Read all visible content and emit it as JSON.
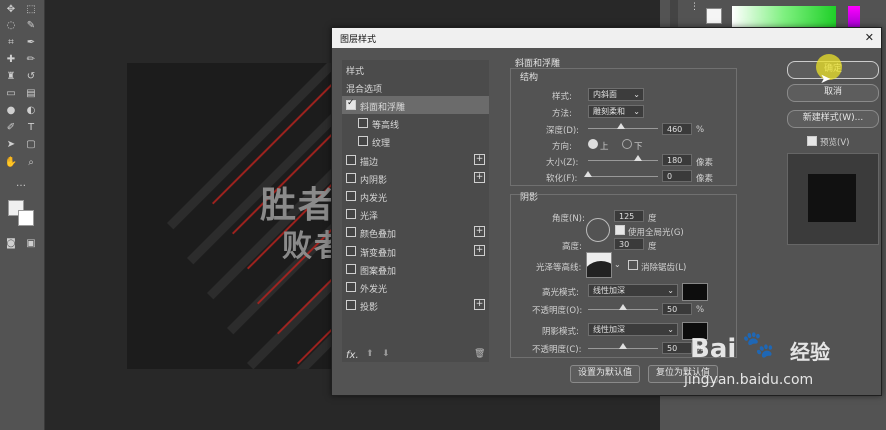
{
  "dialog": {
    "title": "图层样式",
    "close": "✕",
    "style_list": {
      "header": "样式",
      "blend": "混合选项",
      "items": [
        {
          "label": "斜面和浮雕",
          "checked": true,
          "selected": true,
          "plus": false
        },
        {
          "label": "等高线",
          "checked": false,
          "selected": false,
          "plus": false
        },
        {
          "label": "纹理",
          "checked": false,
          "selected": false,
          "plus": false
        },
        {
          "label": "描边",
          "checked": false,
          "selected": false,
          "plus": true
        },
        {
          "label": "内阴影",
          "checked": false,
          "selected": false,
          "plus": true
        },
        {
          "label": "内发光",
          "checked": false,
          "selected": false,
          "plus": false
        },
        {
          "label": "光泽",
          "checked": false,
          "selected": false,
          "plus": false
        },
        {
          "label": "颜色叠加",
          "checked": false,
          "selected": false,
          "plus": true
        },
        {
          "label": "渐变叠加",
          "checked": false,
          "selected": false,
          "plus": true
        },
        {
          "label": "图案叠加",
          "checked": false,
          "selected": false,
          "plus": false
        },
        {
          "label": "外发光",
          "checked": false,
          "selected": false,
          "plus": false
        },
        {
          "label": "投影",
          "checked": false,
          "selected": false,
          "plus": true
        }
      ],
      "fx": "fx."
    },
    "bevel": {
      "section_title": "斜面和浮雕",
      "structure_title": "结构",
      "style_label": "样式:",
      "style_value": "内斜面",
      "technique_label": "方法:",
      "technique_value": "雕刻柔和",
      "depth_label": "深度(D):",
      "depth_value": "460",
      "depth_unit": "%",
      "depth_level": 0.46,
      "direction_label": "方向:",
      "dir_up": "上",
      "dir_down": "下",
      "size_label": "大小(Z):",
      "size_value": "180",
      "size_unit": "像素",
      "size_level": 0.72,
      "soften_label": "软化(F):",
      "soften_value": "0",
      "soften_unit": "像素",
      "soften_level": 0.0
    },
    "shading": {
      "title": "阴影",
      "angle_label": "角度(N):",
      "angle_value": "125",
      "angle_unit": "度",
      "global_light_label": "使用全局光(G)",
      "altitude_label": "高度:",
      "altitude_value": "30",
      "altitude_unit": "度",
      "gloss_label": "光泽等高线:",
      "antialias_label": "消除锯齿(L)",
      "highlight_mode_label": "高光模式:",
      "highlight_mode_value": "线性加深",
      "highlight_opacity_label": "不透明度(O):",
      "highlight_opacity_value": "50",
      "highlight_opacity_unit": "%",
      "highlight_opacity_level": 0.5,
      "shadow_mode_label": "阴影模式:",
      "shadow_mode_value": "线性加深",
      "shadow_opacity_label": "不透明度(C):",
      "shadow_opacity_value": "50",
      "shadow_opacity_unit": "%",
      "shadow_opacity_level": 0.5
    },
    "footer": {
      "default_btn": "设置为默认值",
      "reset_btn": "复位为默认值"
    },
    "buttons": {
      "ok": "确定",
      "cancel": "取消",
      "new_style": "新建样式(W)...",
      "preview": "预览(V)"
    }
  },
  "canvas": {
    "line1": "胜者",
    "line2": "败者"
  },
  "watermark": {
    "brand": "Bai",
    "brand2": "经验",
    "url": "jingyan.baidu.com"
  },
  "colors": {
    "accent_red": "#b3231f",
    "dialog_bg": "#535353",
    "swatch": "#0d0d0d"
  }
}
